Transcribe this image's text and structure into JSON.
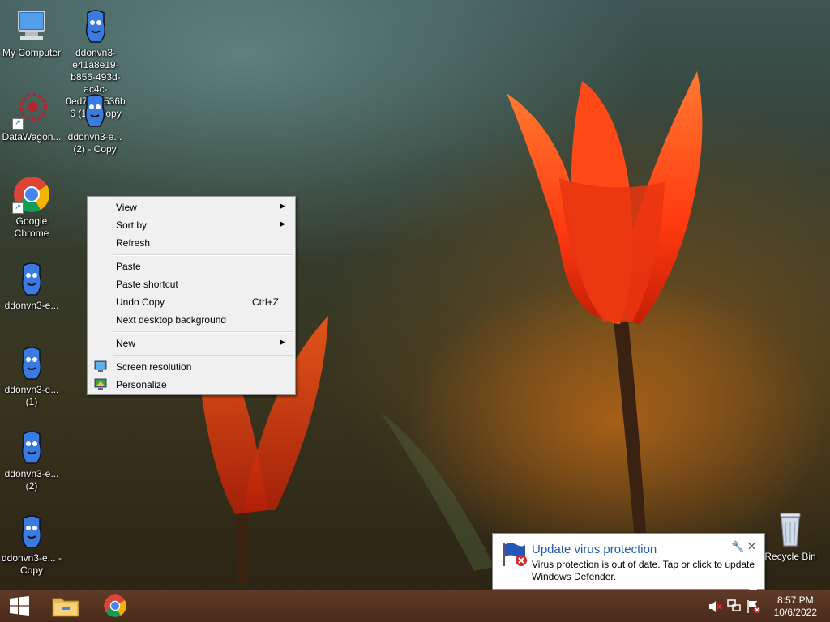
{
  "desktop": {
    "icons": [
      {
        "label": "My Computer",
        "icon": "computer-icon"
      },
      {
        "label": "ddonvn3-e41a8e19-b856-493d-ac4c-0ed7044536b6 (1) - Copy",
        "icon": "blue-creature-icon"
      },
      {
        "label": "DataWagon...",
        "icon": "datawagon-icon"
      },
      {
        "label": "ddonvn3-e... (2) - Copy",
        "icon": "blue-creature-icon"
      },
      {
        "label": "Google Chrome",
        "icon": "chrome-icon"
      },
      {
        "label": "ddonvn3-e...",
        "icon": "blue-creature-icon"
      },
      {
        "label": "ddonvn3-e... (1)",
        "icon": "blue-creature-icon"
      },
      {
        "label": "ddonvn3-e... (2)",
        "icon": "blue-creature-icon"
      },
      {
        "label": "ddonvn3-e... - Copy",
        "icon": "blue-creature-icon"
      },
      {
        "label": "Recycle Bin",
        "icon": "recycle-bin-icon"
      }
    ]
  },
  "context_menu": {
    "items": [
      {
        "label": "View",
        "submenu": true
      },
      {
        "label": "Sort by",
        "submenu": true
      },
      {
        "label": "Refresh"
      },
      {
        "label": "Paste"
      },
      {
        "label": "Paste shortcut"
      },
      {
        "label": "Undo Copy",
        "shortcut": "Ctrl+Z"
      },
      {
        "label": "Next desktop background"
      },
      {
        "label": "New",
        "submenu": true
      },
      {
        "label": "Screen resolution",
        "icon": "screen-resolution-icon"
      },
      {
        "label": "Personalize",
        "icon": "personalize-icon"
      }
    ],
    "submenu_arrow": "▶"
  },
  "notification": {
    "title": "Update virus protection",
    "message": "Virus protection is out of date. Tap or click to update Windows Defender.",
    "icon": "defender-flag-icon"
  },
  "taskbar": {
    "pinned": [
      {
        "name": "Start",
        "icon": "windows-logo-icon"
      },
      {
        "name": "File Explorer",
        "icon": "folder-icon"
      },
      {
        "name": "Google Chrome",
        "icon": "chrome-icon"
      }
    ],
    "tray_icons": [
      "volume-muted-icon",
      "network-icon",
      "action-center-flag-icon"
    ],
    "time": "8:57 PM",
    "date": "10/6/2022"
  },
  "colors": {
    "accent_blue": "#1d59b5",
    "menu_bg": "#f0f0f0",
    "taskbar": "#5a321e"
  }
}
